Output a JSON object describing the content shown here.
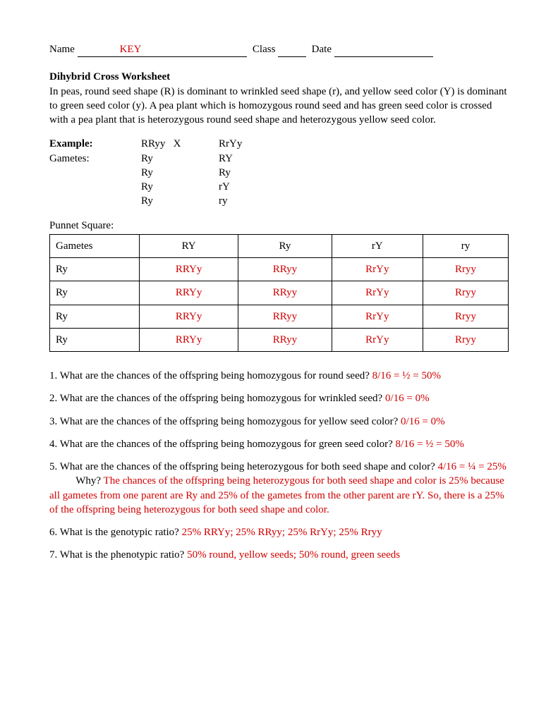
{
  "header": {
    "name_label": "Name",
    "name_value": "KEY",
    "class_label": "Class",
    "date_label": "Date"
  },
  "title": "Dihybrid Cross Worksheet",
  "intro": "In peas, round seed shape (R) is dominant to wrinkled seed shape (r), and yellow seed color (Y) is dominant to green seed color (y). A pea plant which is homozygous round seed and has green seed color is crossed with a pea plant that is heterozygous round seed shape and heterozygous yellow seed color.",
  "example": {
    "label": "Example:",
    "gametes_label": "Gametes:",
    "cross_left": "RRyy",
    "cross_x": "X",
    "cross_right": "RrYy",
    "left_gametes": [
      "Ry",
      "Ry",
      "Ry",
      "Ry"
    ],
    "right_gametes": [
      "RY",
      "Ry",
      "rY",
      "ry"
    ]
  },
  "punnett": {
    "label": "Punnet Square:",
    "corner": "Gametes",
    "cols": [
      "RY",
      "Ry",
      "rY",
      "ry"
    ],
    "rows": [
      {
        "label": "Ry",
        "cells": [
          "RRYy",
          "RRyy",
          "RrYy",
          "Rryy"
        ]
      },
      {
        "label": "Ry",
        "cells": [
          "RRYy",
          "RRyy",
          "RrYy",
          "Rryy"
        ]
      },
      {
        "label": "Ry",
        "cells": [
          "RRYy",
          "RRyy",
          "RrYy",
          "Rryy"
        ]
      },
      {
        "label": "Ry",
        "cells": [
          "RRYy",
          "RRyy",
          "RrYy",
          "Rryy"
        ]
      }
    ]
  },
  "questions": {
    "q1": {
      "text": "1. What are the chances of the offspring being homozygous for round seed? ",
      "ans": "8/16 = ½ = 50%"
    },
    "q2": {
      "text": "2. What are the chances of the offspring being homozygous for wrinkled seed? ",
      "ans": "0/16 = 0%"
    },
    "q3": {
      "text": "3. What are the chances of the offspring being homozygous for yellow seed color? ",
      "ans": "0/16 = 0%"
    },
    "q4": {
      "text": "4. What are the chances of the offspring being homozygous for green seed color? ",
      "ans": "8/16 = ½ = 50%"
    },
    "q5": {
      "text1": "5. What are the chances of the offspring being heterozygous for both seed shape and color? ",
      "ans1": "4/16 = ¼ = 25%",
      "why_label": "Why? ",
      "ans2": "The chances of the offspring being heterozygous for both seed shape and color is 25% because all gametes from one parent are Ry and 25% of the gametes from the other parent are rY.  So, there is a 25% of the offspring being heterozygous for both seed shape and color."
    },
    "q6": {
      "text": "6. What is the genotypic ratio? ",
      "ans": "25% RRYy; 25% RRyy; 25% RrYy; 25% Rryy"
    },
    "q7": {
      "text": "7. What is the phenotypic ratio? ",
      "ans": "50% round, yellow seeds; 50% round, green seeds"
    }
  }
}
